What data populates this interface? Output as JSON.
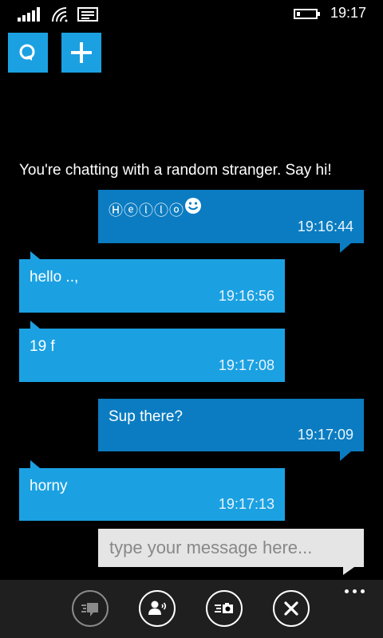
{
  "status_bar": {
    "time": "19:17",
    "icons": [
      "signal-icon",
      "wifi-icon",
      "message-icon",
      "battery-icon"
    ]
  },
  "top_buttons": [
    {
      "name": "chat-search-icon"
    },
    {
      "name": "plus-icon"
    }
  ],
  "intro_text": "You're chatting with a random stranger. Say hi!",
  "messages": [
    {
      "direction": "out",
      "text": "Ⓗⓔⓛⓛⓞ",
      "emoji": "smiley-icon",
      "time": "19:16:44"
    },
    {
      "direction": "in",
      "text": "hello ..,",
      "time": "19:16:56"
    },
    {
      "direction": "in",
      "text": "19 f",
      "time": "19:17:08"
    },
    {
      "direction": "out",
      "text": "Sup there?",
      "time": "19:17:09"
    },
    {
      "direction": "in",
      "text": "horny",
      "time": "19:17:13"
    }
  ],
  "input": {
    "placeholder": "type your message here...",
    "value": ""
  },
  "app_bar": {
    "buttons": [
      "chat-bubble-icon",
      "voice-user-icon",
      "photo-message-icon",
      "close-icon"
    ],
    "more": "more-dots-icon"
  },
  "colors": {
    "accent": "#1ba1e2",
    "outgoing": "#0b7cc1",
    "background": "#000000",
    "appbar": "#1f1f1f"
  }
}
